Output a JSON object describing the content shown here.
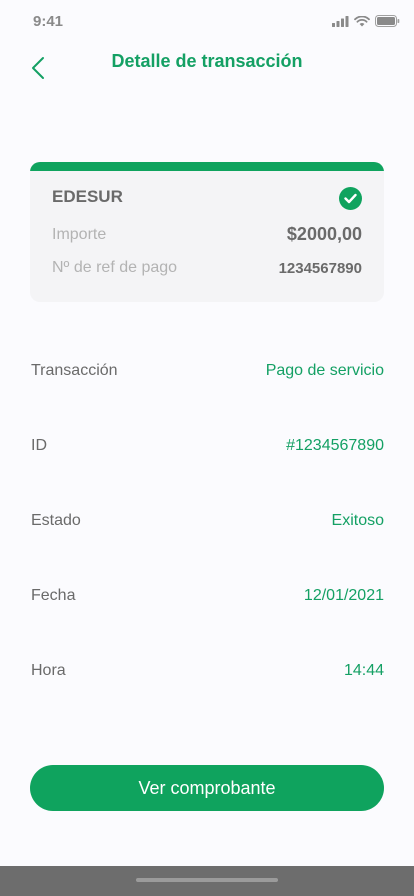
{
  "status_bar": {
    "time": "9:41",
    "icons": [
      "signal-icon",
      "wifi-icon",
      "battery-icon"
    ]
  },
  "header": {
    "title": "Detalle de transacción",
    "back_icon": "chevron-left-icon"
  },
  "summary_card": {
    "company": "EDESUR",
    "status_icon": "check-circle-icon",
    "amount_label": "Importe",
    "amount_value": "$2000,00",
    "ref_label": "Nº de ref de pago",
    "ref_value": "1234567890"
  },
  "details": [
    {
      "label": "Transacción",
      "value": "Pago de servicio"
    },
    {
      "label": "ID",
      "value": "#1234567890"
    },
    {
      "label": "Estado",
      "value": "Exitoso"
    },
    {
      "label": "Fecha",
      "value": "12/01/2021"
    },
    {
      "label": "Hora",
      "value": "14:44"
    }
  ],
  "actions": {
    "receipt_button": "Ver comprobante"
  },
  "colors": {
    "accent": "#0fa35e",
    "accent_text": "#14a064",
    "background": "#fbfbfe",
    "card_background": "#f4f4f6",
    "text_primary": "#6a6a6a",
    "text_muted": "#b3b3b3"
  }
}
